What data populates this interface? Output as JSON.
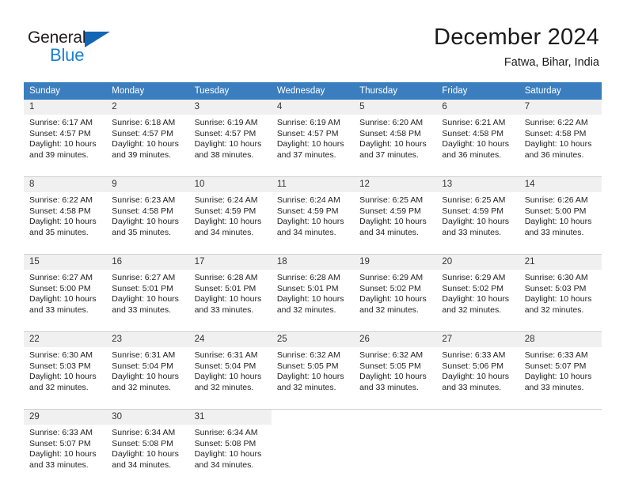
{
  "brand": {
    "name_top": "General",
    "name_bottom": "Blue",
    "accent_color": "#1b7fd4",
    "triangle_color": "#1266b5"
  },
  "header": {
    "title": "December 2024",
    "subtitle": "Fatwa, Bihar, India"
  },
  "theme": {
    "header_row_bg": "#3b7ebf",
    "daynum_bg": "#f0f0f0",
    "border_color": "#cfcfcf"
  },
  "weekday_headers": [
    "Sunday",
    "Monday",
    "Tuesday",
    "Wednesday",
    "Thursday",
    "Friday",
    "Saturday"
  ],
  "weeks": [
    [
      {
        "day": "1",
        "sunrise": "Sunrise: 6:17 AM",
        "sunset": "Sunset: 4:57 PM",
        "daylight1": "Daylight: 10 hours",
        "daylight2": "and 39 minutes."
      },
      {
        "day": "2",
        "sunrise": "Sunrise: 6:18 AM",
        "sunset": "Sunset: 4:57 PM",
        "daylight1": "Daylight: 10 hours",
        "daylight2": "and 39 minutes."
      },
      {
        "day": "3",
        "sunrise": "Sunrise: 6:19 AM",
        "sunset": "Sunset: 4:57 PM",
        "daylight1": "Daylight: 10 hours",
        "daylight2": "and 38 minutes."
      },
      {
        "day": "4",
        "sunrise": "Sunrise: 6:19 AM",
        "sunset": "Sunset: 4:57 PM",
        "daylight1": "Daylight: 10 hours",
        "daylight2": "and 37 minutes."
      },
      {
        "day": "5",
        "sunrise": "Sunrise: 6:20 AM",
        "sunset": "Sunset: 4:58 PM",
        "daylight1": "Daylight: 10 hours",
        "daylight2": "and 37 minutes."
      },
      {
        "day": "6",
        "sunrise": "Sunrise: 6:21 AM",
        "sunset": "Sunset: 4:58 PM",
        "daylight1": "Daylight: 10 hours",
        "daylight2": "and 36 minutes."
      },
      {
        "day": "7",
        "sunrise": "Sunrise: 6:22 AM",
        "sunset": "Sunset: 4:58 PM",
        "daylight1": "Daylight: 10 hours",
        "daylight2": "and 36 minutes."
      }
    ],
    [
      {
        "day": "8",
        "sunrise": "Sunrise: 6:22 AM",
        "sunset": "Sunset: 4:58 PM",
        "daylight1": "Daylight: 10 hours",
        "daylight2": "and 35 minutes."
      },
      {
        "day": "9",
        "sunrise": "Sunrise: 6:23 AM",
        "sunset": "Sunset: 4:58 PM",
        "daylight1": "Daylight: 10 hours",
        "daylight2": "and 35 minutes."
      },
      {
        "day": "10",
        "sunrise": "Sunrise: 6:24 AM",
        "sunset": "Sunset: 4:59 PM",
        "daylight1": "Daylight: 10 hours",
        "daylight2": "and 34 minutes."
      },
      {
        "day": "11",
        "sunrise": "Sunrise: 6:24 AM",
        "sunset": "Sunset: 4:59 PM",
        "daylight1": "Daylight: 10 hours",
        "daylight2": "and 34 minutes."
      },
      {
        "day": "12",
        "sunrise": "Sunrise: 6:25 AM",
        "sunset": "Sunset: 4:59 PM",
        "daylight1": "Daylight: 10 hours",
        "daylight2": "and 34 minutes."
      },
      {
        "day": "13",
        "sunrise": "Sunrise: 6:25 AM",
        "sunset": "Sunset: 4:59 PM",
        "daylight1": "Daylight: 10 hours",
        "daylight2": "and 33 minutes."
      },
      {
        "day": "14",
        "sunrise": "Sunrise: 6:26 AM",
        "sunset": "Sunset: 5:00 PM",
        "daylight1": "Daylight: 10 hours",
        "daylight2": "and 33 minutes."
      }
    ],
    [
      {
        "day": "15",
        "sunrise": "Sunrise: 6:27 AM",
        "sunset": "Sunset: 5:00 PM",
        "daylight1": "Daylight: 10 hours",
        "daylight2": "and 33 minutes."
      },
      {
        "day": "16",
        "sunrise": "Sunrise: 6:27 AM",
        "sunset": "Sunset: 5:01 PM",
        "daylight1": "Daylight: 10 hours",
        "daylight2": "and 33 minutes."
      },
      {
        "day": "17",
        "sunrise": "Sunrise: 6:28 AM",
        "sunset": "Sunset: 5:01 PM",
        "daylight1": "Daylight: 10 hours",
        "daylight2": "and 33 minutes."
      },
      {
        "day": "18",
        "sunrise": "Sunrise: 6:28 AM",
        "sunset": "Sunset: 5:01 PM",
        "daylight1": "Daylight: 10 hours",
        "daylight2": "and 32 minutes."
      },
      {
        "day": "19",
        "sunrise": "Sunrise: 6:29 AM",
        "sunset": "Sunset: 5:02 PM",
        "daylight1": "Daylight: 10 hours",
        "daylight2": "and 32 minutes."
      },
      {
        "day": "20",
        "sunrise": "Sunrise: 6:29 AM",
        "sunset": "Sunset: 5:02 PM",
        "daylight1": "Daylight: 10 hours",
        "daylight2": "and 32 minutes."
      },
      {
        "day": "21",
        "sunrise": "Sunrise: 6:30 AM",
        "sunset": "Sunset: 5:03 PM",
        "daylight1": "Daylight: 10 hours",
        "daylight2": "and 32 minutes."
      }
    ],
    [
      {
        "day": "22",
        "sunrise": "Sunrise: 6:30 AM",
        "sunset": "Sunset: 5:03 PM",
        "daylight1": "Daylight: 10 hours",
        "daylight2": "and 32 minutes."
      },
      {
        "day": "23",
        "sunrise": "Sunrise: 6:31 AM",
        "sunset": "Sunset: 5:04 PM",
        "daylight1": "Daylight: 10 hours",
        "daylight2": "and 32 minutes."
      },
      {
        "day": "24",
        "sunrise": "Sunrise: 6:31 AM",
        "sunset": "Sunset: 5:04 PM",
        "daylight1": "Daylight: 10 hours",
        "daylight2": "and 32 minutes."
      },
      {
        "day": "25",
        "sunrise": "Sunrise: 6:32 AM",
        "sunset": "Sunset: 5:05 PM",
        "daylight1": "Daylight: 10 hours",
        "daylight2": "and 32 minutes."
      },
      {
        "day": "26",
        "sunrise": "Sunrise: 6:32 AM",
        "sunset": "Sunset: 5:05 PM",
        "daylight1": "Daylight: 10 hours",
        "daylight2": "and 33 minutes."
      },
      {
        "day": "27",
        "sunrise": "Sunrise: 6:33 AM",
        "sunset": "Sunset: 5:06 PM",
        "daylight1": "Daylight: 10 hours",
        "daylight2": "and 33 minutes."
      },
      {
        "day": "28",
        "sunrise": "Sunrise: 6:33 AM",
        "sunset": "Sunset: 5:07 PM",
        "daylight1": "Daylight: 10 hours",
        "daylight2": "and 33 minutes."
      }
    ],
    [
      {
        "day": "29",
        "sunrise": "Sunrise: 6:33 AM",
        "sunset": "Sunset: 5:07 PM",
        "daylight1": "Daylight: 10 hours",
        "daylight2": "and 33 minutes."
      },
      {
        "day": "30",
        "sunrise": "Sunrise: 6:34 AM",
        "sunset": "Sunset: 5:08 PM",
        "daylight1": "Daylight: 10 hours",
        "daylight2": "and 34 minutes."
      },
      {
        "day": "31",
        "sunrise": "Sunrise: 6:34 AM",
        "sunset": "Sunset: 5:08 PM",
        "daylight1": "Daylight: 10 hours",
        "daylight2": "and 34 minutes."
      },
      {
        "day": "",
        "sunrise": "",
        "sunset": "",
        "daylight1": "",
        "daylight2": ""
      },
      {
        "day": "",
        "sunrise": "",
        "sunset": "",
        "daylight1": "",
        "daylight2": ""
      },
      {
        "day": "",
        "sunrise": "",
        "sunset": "",
        "daylight1": "",
        "daylight2": ""
      },
      {
        "day": "",
        "sunrise": "",
        "sunset": "",
        "daylight1": "",
        "daylight2": ""
      }
    ]
  ]
}
